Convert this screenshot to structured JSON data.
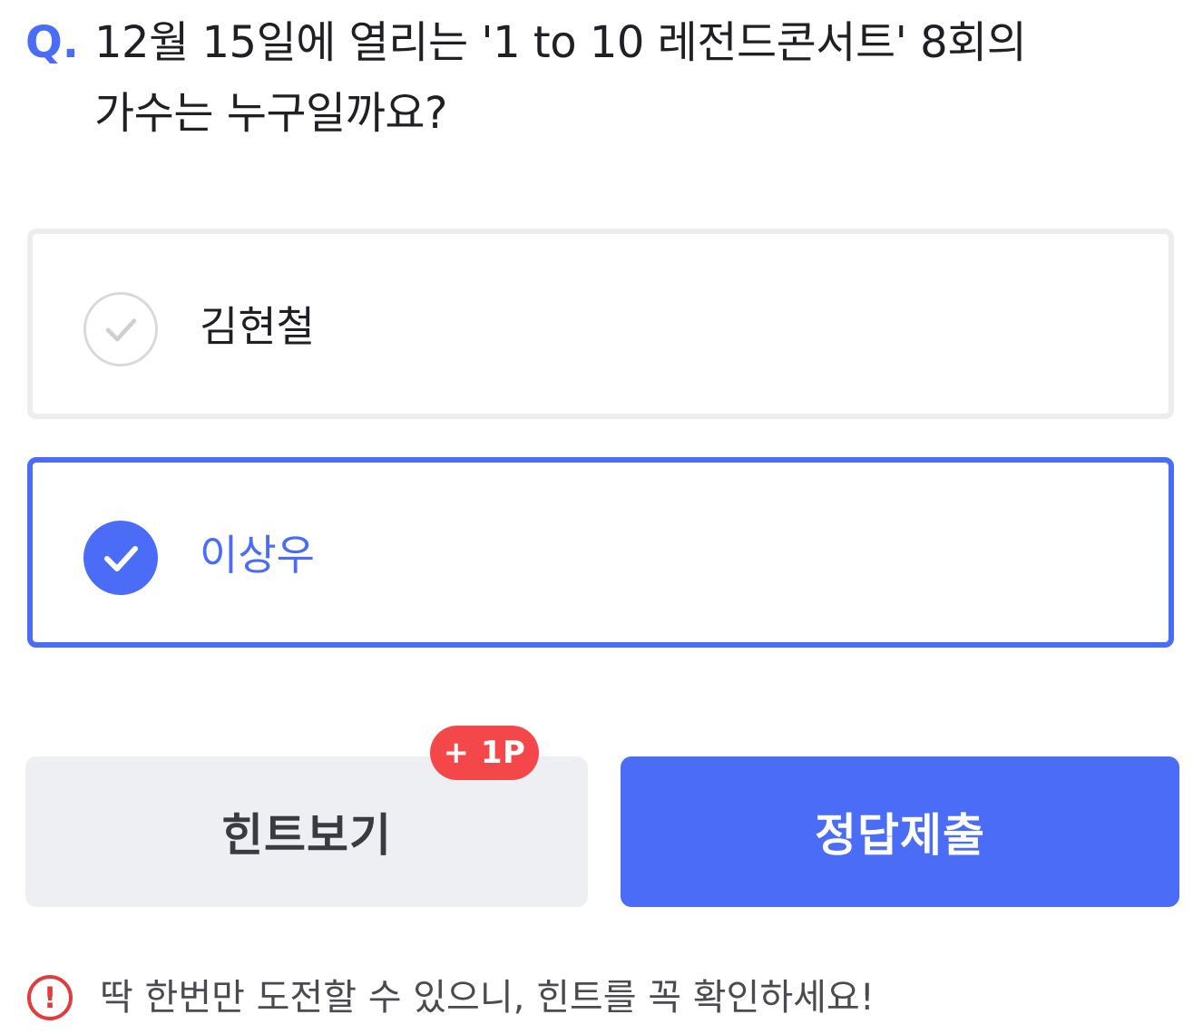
{
  "question": {
    "prefix": "Q.",
    "line1": "12월 15일에 열리는 '1 to 10 레전드콘서트' 8회의",
    "line2": "가수는 누구일까요?"
  },
  "options": [
    {
      "label": "김현철",
      "selected": false
    },
    {
      "label": "이상우",
      "selected": true
    }
  ],
  "buttons": {
    "hint_label": "힌트보기",
    "hint_badge": "+ 1P",
    "submit_label": "정답제출"
  },
  "notice": {
    "icon": "exclamation-circle-icon",
    "text": "딱 한번만 도전할 수 있으니, 힌트를 꼭 확인하세요!"
  },
  "colors": {
    "accent": "#4a6cf7",
    "badge": "#f4474a",
    "warning": "#e23b3b",
    "hint_bg": "#eeeff3"
  }
}
